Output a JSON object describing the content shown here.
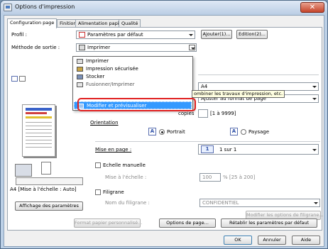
{
  "window": {
    "title": "Options d'impression",
    "close_glyph": "✕"
  },
  "tabs": [
    "Configuration page",
    "Finition",
    "Alimentation papier",
    "Qualité"
  ],
  "profile": {
    "label": "Profil :",
    "value": "Paramètres par défaut",
    "add_button": "Ajouter(1)...",
    "edit_button": "Edition(2)..."
  },
  "output": {
    "label": "Méthode de sortie :",
    "value": "Imprimer",
    "options": [
      "Imprimer",
      "Impression sécurisée",
      "Stocker",
      "Fusionner/Imprimer",
      "Modifier et prévisualiser"
    ],
    "selected_index": 4
  },
  "tooltip": "ombiner les travaux d'impression, etc.",
  "right_fields": {
    "paper_size_value": "A4",
    "output_size_value": "Ajuster au format de page",
    "scale_label": "copies",
    "scale_range": "[1 à 9999]"
  },
  "orientation": {
    "label": "Orientation",
    "portrait": "Portrait",
    "landscape": "Paysage",
    "icon_letter": "A"
  },
  "layout": {
    "label": "Mise en page :",
    "value": "1 sur 1",
    "icon_number": "1"
  },
  "manual_scale": {
    "label": "Echelle manuelle",
    "field_label": "Mise à l'échelle :",
    "value": "100",
    "range": "% [25 à 200]"
  },
  "watermark": {
    "label": "Filigrane",
    "field_label": "Nom du filigrane :",
    "value": "CONFIDENTIEL",
    "edit_button": "Modifier les options de filigrane..."
  },
  "preview": {
    "caption": "A4 [Mise à l'échelle : Auto]",
    "show_settings_button": "Affichage des paramètres"
  },
  "bottom_buttons": {
    "custom_paper": "Format papier personnalisé...",
    "page_options": "Options de page...",
    "restore": "Rétablir les paramètres par défaut"
  },
  "dialog_buttons": {
    "ok": "OK",
    "cancel": "Annuler",
    "help": "Aide"
  },
  "colors": {
    "highlight": "#3399ff",
    "callout": "#e02020",
    "title_bg": "#bcd0e6"
  }
}
